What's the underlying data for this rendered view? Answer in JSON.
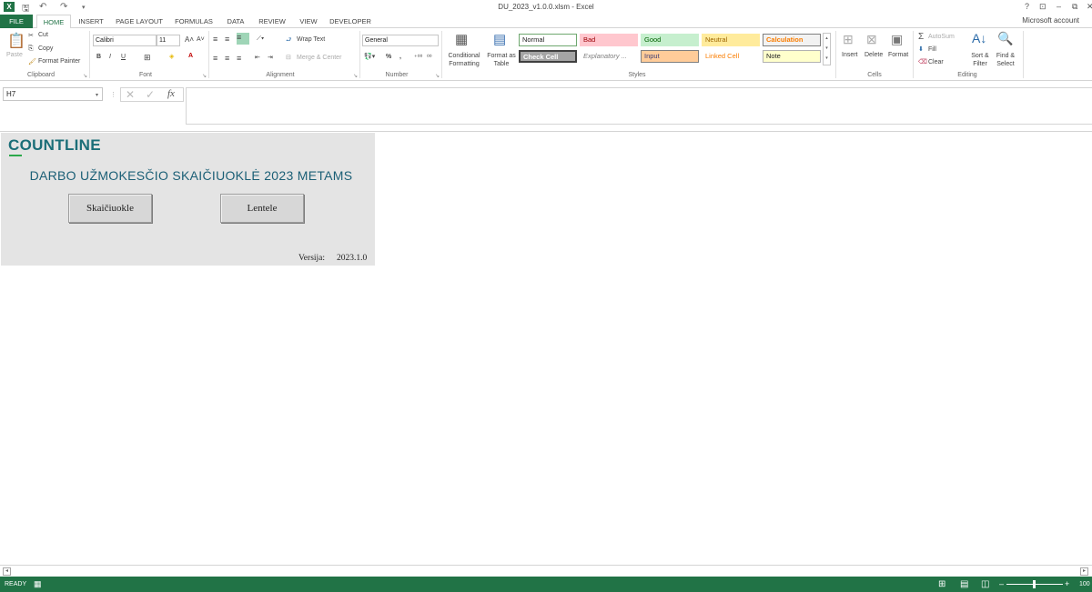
{
  "window": {
    "title": "DU_2023_v1.0.0.xlsm - Excel"
  },
  "titlebar": {
    "app_icon": "X",
    "help": "?",
    "restore_ribbon": "⊡",
    "minimize": "–",
    "maximize": "⧉",
    "close": "✕"
  },
  "tabs": [
    {
      "label": "FILE"
    },
    {
      "label": "HOME"
    },
    {
      "label": "INSERT"
    },
    {
      "label": "PAGE LAYOUT"
    },
    {
      "label": "FORMULAS"
    },
    {
      "label": "DATA"
    },
    {
      "label": "REVIEW"
    },
    {
      "label": "VIEW"
    },
    {
      "label": "DEVELOPER"
    }
  ],
  "account": "Microsoft account",
  "ribbon": {
    "clipboard": {
      "paste": "Paste",
      "cut": "Cut",
      "copy": "Copy",
      "format_painter": "Format Painter",
      "label": "Clipboard"
    },
    "font": {
      "name": "Calibri",
      "size": "11",
      "bold": "B",
      "italic": "I",
      "underline": "U",
      "label": "Font"
    },
    "alignment": {
      "wrap_text": "Wrap Text",
      "merge_center": "Merge & Center",
      "label": "Alignment"
    },
    "number": {
      "format": "General",
      "percent": "%",
      "comma": ",",
      "label": "Number"
    },
    "styles": {
      "conditional_formatting": "Conditional Formatting",
      "format_as_table": "Format as Table",
      "cells": [
        {
          "name": "Normal",
          "bg": "#ffffff",
          "fg": "#222222",
          "border": "#6fa86f"
        },
        {
          "name": "Bad",
          "bg": "#ffc7ce",
          "fg": "#9c0006",
          "border": "#ffc7ce"
        },
        {
          "name": "Good",
          "bg": "#c6efce",
          "fg": "#006100",
          "border": "#c6efce"
        },
        {
          "name": "Neutral",
          "bg": "#ffeb9c",
          "fg": "#9c6500",
          "border": "#ffeb9c"
        },
        {
          "name": "Calculation",
          "bg": "#f2f2f2",
          "fg": "#fa7d00",
          "border": "#7f7f7f"
        },
        {
          "name": "Check Cell",
          "bg": "#a5a5a5",
          "fg": "#ffffff",
          "border": "#3f3f3f"
        },
        {
          "name": "Explanatory ...",
          "bg": "#ffffff",
          "fg": "#7f7f7f",
          "border": "#ffffff"
        },
        {
          "name": "Input",
          "bg": "#ffcc99",
          "fg": "#3f3f76",
          "border": "#7f7f7f"
        },
        {
          "name": "Linked Cell",
          "bg": "#ffffff",
          "fg": "#fa7d00",
          "border": "#ffffff"
        },
        {
          "name": "Note",
          "bg": "#ffffcc",
          "fg": "#222222",
          "border": "#b2b2b2"
        }
      ],
      "label": "Styles"
    },
    "cells": {
      "insert": "Insert",
      "delete": "Delete",
      "format": "Format",
      "label": "Cells"
    },
    "editing": {
      "autosum": "AutoSum",
      "fill": "Fill",
      "clear": "Clear",
      "sort_filter": "Sort & Filter",
      "find_select": "Find & Select",
      "label": "Editing"
    }
  },
  "formula_bar": {
    "name_box": "H7",
    "fx": "fx",
    "formula": ""
  },
  "sheet": {
    "brand": "COUNTLINE",
    "heading": "DARBO UŽMOKESČIO SKAIČIUOKLĖ 2023 METAMS",
    "button_calc": "Skaičiuokle",
    "button_table": "Lentele",
    "version_label": "Versija:",
    "version_value": "2023.1.0"
  },
  "status": {
    "state": "READY",
    "zoom": "100"
  },
  "colors": {
    "excel_green": "#217346",
    "brand_teal": "#1b6e78",
    "brand_accent": "#2ba84a",
    "panel_bg": "#e4e4e4"
  }
}
